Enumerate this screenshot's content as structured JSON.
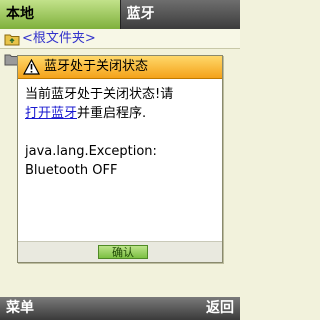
{
  "tabs": [
    {
      "label": "本地",
      "active": true
    },
    {
      "label": "蓝牙",
      "active": false
    }
  ],
  "list": {
    "root_item": "<根文件夹>",
    "root_icon": "folder-up-icon",
    "second_icon": "folder-icon"
  },
  "dialog": {
    "icon": "warning-icon",
    "title": "蓝牙处于关闭状态",
    "line1": "当前蓝牙处于关闭状态!请",
    "link_text": "打开蓝牙",
    "line2_rest": "并重启程序.",
    "exception_line1": "java.lang.Exception:",
    "exception_line2": "Bluetooth OFF",
    "ok_label": "确认"
  },
  "softkeys": {
    "left": "菜单",
    "right": "返回"
  },
  "colors": {
    "active_tab": "#9ccc5a",
    "dialog_title": "#f7b733",
    "link": "#1a1ad0",
    "ok_button": "#8fcf52"
  }
}
